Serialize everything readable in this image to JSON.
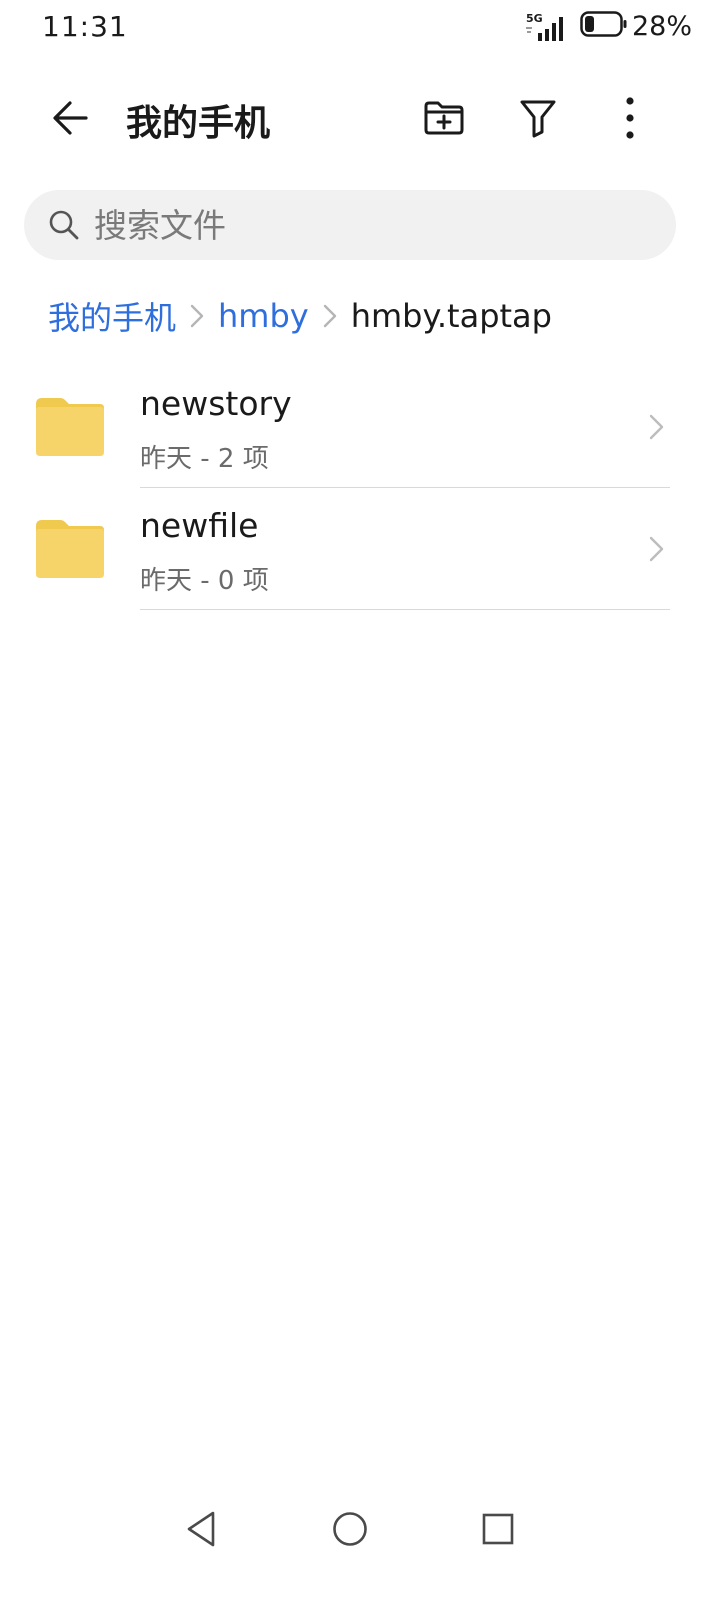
{
  "status_bar": {
    "time": "11:31",
    "network": "5G",
    "battery_percent": "28%",
    "battery_level": 0.28
  },
  "header": {
    "title": "我的手机",
    "icons": [
      "arrow-back-icon",
      "new-folder-icon",
      "filter-icon",
      "more-vertical-icon"
    ]
  },
  "search": {
    "placeholder": "搜索文件",
    "value": ""
  },
  "breadcrumb": {
    "items": [
      {
        "label": "我的手机"
      },
      {
        "label": "hmby"
      },
      {
        "label": "hmby.taptap"
      }
    ]
  },
  "files": [
    {
      "name": "newstory",
      "meta": "昨天 - 2 项",
      "icon": "folder-icon"
    },
    {
      "name": "newfile",
      "meta": "昨天 - 0 项",
      "icon": "folder-icon"
    }
  ],
  "colors": {
    "accent": "#2f6fdd",
    "folder": "#f6d46a",
    "folder_tab": "#f0c94f",
    "search_bg": "#f1f1f1",
    "divider": "#d9d9d9"
  },
  "nav": {
    "icons": [
      "nav-back-icon",
      "nav-home-icon",
      "nav-recents-icon"
    ]
  }
}
